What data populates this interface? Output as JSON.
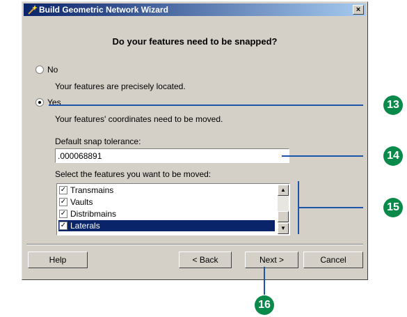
{
  "window": {
    "title": "Build Geometric Network Wizard",
    "close_label": "×"
  },
  "heading": "Do your features need to be snapped?",
  "options": {
    "no": {
      "label": "No",
      "description": "Your features are precisely located.",
      "selected": false
    },
    "yes": {
      "label": "Yes",
      "description": "Your features' coordinates need to be moved.",
      "selected": true
    }
  },
  "snap_tolerance": {
    "label": "Default snap tolerance:",
    "value": ".000068891"
  },
  "features": {
    "label": "Select the features you want to be moved:",
    "items": [
      {
        "label": "Transmains",
        "checked": true
      },
      {
        "label": "Vaults",
        "checked": true
      },
      {
        "label": "Distribmains",
        "checked": true
      },
      {
        "label": "Laterals",
        "checked": true,
        "selected": true
      }
    ]
  },
  "buttons": {
    "help": "Help",
    "back": "< Back",
    "next": "Next >",
    "cancel": "Cancel"
  },
  "callouts": [
    "13",
    "14",
    "15",
    "16"
  ],
  "colors": {
    "titlebar_start": "#0a246a",
    "titlebar_end": "#a6caf0",
    "callout": "#0a8a4a",
    "callout_line": "#1c55a8"
  }
}
